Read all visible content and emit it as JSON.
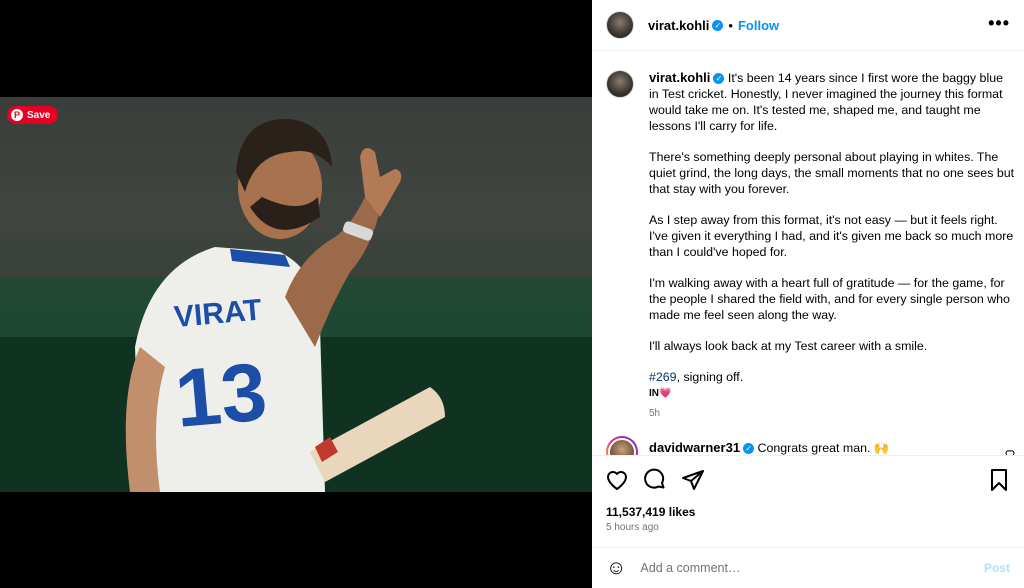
{
  "media": {
    "save_label": "Save",
    "pin_icon": "P",
    "jersey_name": "VIRAT",
    "jersey_number": "13"
  },
  "header": {
    "username": "virat.kohli",
    "separator": "•",
    "follow_label": "Follow",
    "more_icon": "•••"
  },
  "caption": {
    "username": "virat.kohli",
    "paragraphs": [
      "It's been 14 years since I first wore the baggy blue in Test cricket. Honestly, I never imagined the journey this format would take me on. It's tested me, shaped me, and taught me lessons I'll carry for life.",
      "There's something deeply personal about playing in whites. The quiet grind, the long days, the small moments that no one sees but that stay with you forever.",
      "As I step away from this format, it's not easy — but it feels right. I've given it everything I had, and it's given me back so much more than I could've hoped for.",
      "I'm walking away with a heart full of gratitude — for the game, for the people I shared the field with, and for every single person who made me feel seen along the way.",
      "I'll always look back at my Test career with a smile."
    ],
    "hashtag": "#269",
    "hashtag_suffix": ", signing off.",
    "sign": "IN",
    "sign_emoji": "💗",
    "time": "5h"
  },
  "reply": {
    "username": "davidwarner31",
    "text": "Congrats great man. 🙌"
  },
  "actions": {
    "likes": "11,537,419 likes",
    "ago": "5 hours ago"
  },
  "add_comment": {
    "emoji_icon": "☺",
    "placeholder": "Add a comment…",
    "post_label": "Post"
  },
  "colors": {
    "accent": "#0095f6",
    "pinterest": "#e60023",
    "hashtag": "#00376b",
    "muted": "#737373"
  }
}
